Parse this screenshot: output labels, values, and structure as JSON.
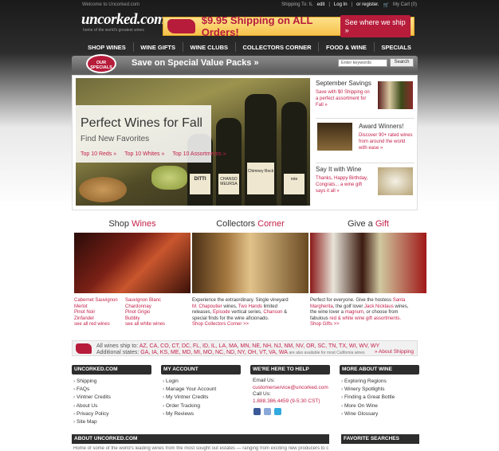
{
  "header": {
    "welcome": "Welcome to Uncorked.com",
    "shipping_to": "Shipping To: IL",
    "edit": "edit",
    "login": "Log In",
    "or_register": "or register.",
    "cart": "My Cart (0)",
    "logo": "uncorked.com",
    "tagline": "home of the world's greatest wines"
  },
  "shipping_banner": {
    "text": "$9.95 Shipping on ALL Orders!",
    "button": "See where we ship »"
  },
  "nav": [
    "SHOP WINES",
    "WINE GIFTS",
    "WINE CLUBS",
    "COLLECTORS CORNER",
    "FOOD & WINE",
    "SPECIALS"
  ],
  "specials_bar": {
    "badge_line1": "OUR",
    "badge_line2": "SPECIALS",
    "text": "Save on Special Value Packs »",
    "search_placeholder": "Enter keywords",
    "search_button": "Search"
  },
  "hero": {
    "title": "Perfect Wines for Fall",
    "subtitle": "Find New Favorites",
    "links": [
      "Top 10 Reds »",
      "Top 10 Whites »",
      "Top 10 Assortments »"
    ],
    "bottle_labels": [
      "DITTI",
      "CHANSO MEURSA",
      "Chimney Rock",
      "rote"
    ]
  },
  "sidebar": [
    {
      "title": "September Savings",
      "desc": "Save with $0 Shipping on a perfect assortment for Fall »"
    },
    {
      "title": "Award Winners!",
      "desc": "Discover 90+ rated wines from around the world with ease »"
    },
    {
      "title": "Say It with Wine",
      "desc": "Thanks, Happy Birthday, Congrats... a wine gift says it all »"
    }
  ],
  "columns": {
    "shop": {
      "title_a": "Shop ",
      "title_b": "Wines",
      "left": [
        "Cabernet Sauvignon",
        "Merlot",
        "Pinot Noir",
        "Zinfandel",
        "see all red wines"
      ],
      "right": [
        "Sauvignon Blanc",
        "Chardonnay",
        "Pinot Grigio",
        "Bubbly",
        "see all white wines"
      ]
    },
    "collectors": {
      "title_a": "Collectors ",
      "title_b": "Corner",
      "t1": "Experience the extraordinary. Single vineyard",
      "t2": "M. Chapoutier",
      "t3": " wines, ",
      "t4": "Two Hands",
      "t5": " limited",
      "t6": "releases, ",
      "t7": "Episode",
      "t8": " vertical series, ",
      "t9": "Chanson",
      "t10": " &",
      "t11": "special finds for the wine aficionado.",
      "link": "Shop Collectors Corner >>"
    },
    "gift": {
      "title_a": "Give a ",
      "title_b": "Gift",
      "t1": "Perfect for everyone. Give the hostess ",
      "t2": "Santa",
      "t3": "Margherita",
      "t4": ", the golf lover ",
      "t5": "Jack Nicklaus",
      "t6": " wines,",
      "t7": "the wine lover a ",
      "t8": "magnum",
      "t9": ", or choose from",
      "t10": "fabulous ",
      "t11": "red & white wine gift assortments.",
      "link": "Shop Gifts >>"
    }
  },
  "states": {
    "label1": "All wines ship to:",
    "list1": "AZ, CA, CO, CT, DC, FL, ID, IL, LA, MA, MN, NE, NH, NJ, NM, NV, OR, SC, TN, TX, WI, WV, WY",
    "label2": "Additional states:",
    "list2": "GA, IA, KS, ME, MD, MI, MO, NC, ND, NY, OH, VT, VA, WA",
    "note": "are also available for most California wines",
    "about": "» About Shipping"
  },
  "footer": {
    "uncorked": {
      "title": "UNCORKED.COM",
      "items": [
        "Shipping",
        "FAQs",
        "Vintner Credits",
        "About Us",
        "Privacy Policy",
        "Site Map"
      ]
    },
    "account": {
      "title": "MY ACCOUNT",
      "items": [
        "Login",
        "Manage Your Account",
        "My Vintner Credits",
        "Order Tracking",
        "My Reviews"
      ]
    },
    "help": {
      "title": "WE'RE HERE TO HELP",
      "email_label": "Email Us:",
      "email": "customerservice@uncorked.com",
      "call_label": "Call Us:",
      "phone": "1.888.386.4459 (9-5:30 CST)"
    },
    "more": {
      "title": "MORE ABOUT WINE",
      "items": [
        "Exploring Regions",
        "Winery Spotlights",
        "Finding a Great Bottle",
        "More On Wine",
        "Wine Glossary"
      ]
    },
    "about_title": "ABOUT UNCORKED.COM",
    "favorites_title": "FAVORITE SEARCHES",
    "about_text": "Home of some of the world's leading wines from the most sought out estates — ranging from exciting new producers to classic..."
  }
}
